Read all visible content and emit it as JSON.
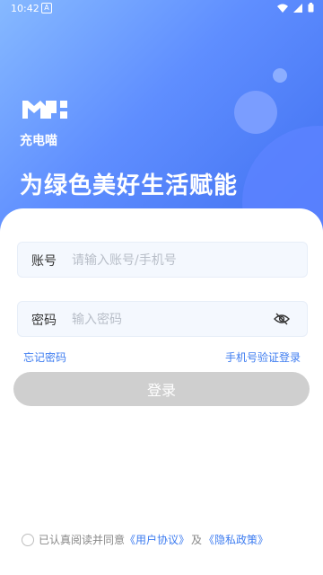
{
  "status_bar": {
    "time": "10:42",
    "notification_icon": "a-app-icon",
    "icons": [
      "wifi-icon",
      "signal-icon",
      "battery-icon"
    ]
  },
  "hero": {
    "logo_text": "充电喵",
    "slogan": "为绿色美好生活赋能"
  },
  "form": {
    "account_label": "账号",
    "account_placeholder": "请输入账号/手机号",
    "password_label": "密码",
    "password_placeholder": "输入密码",
    "password_toggle_icon": "eye-off-icon"
  },
  "links": {
    "forgot_password": "忘记密码",
    "sms_login": "手机号验证登录"
  },
  "login_button": "登录",
  "agreement": {
    "prefix": "已认真阅读并同意",
    "user_agreement": "《用户协议》",
    "and": "及",
    "privacy_policy": "《隐私政策》"
  },
  "colors": {
    "hero_gradient_start": "#86b9ff",
    "hero_gradient_end": "#3f6ff0",
    "accent_link": "#3d7cf0",
    "login_button_disabled": "#cfcfcf"
  }
}
